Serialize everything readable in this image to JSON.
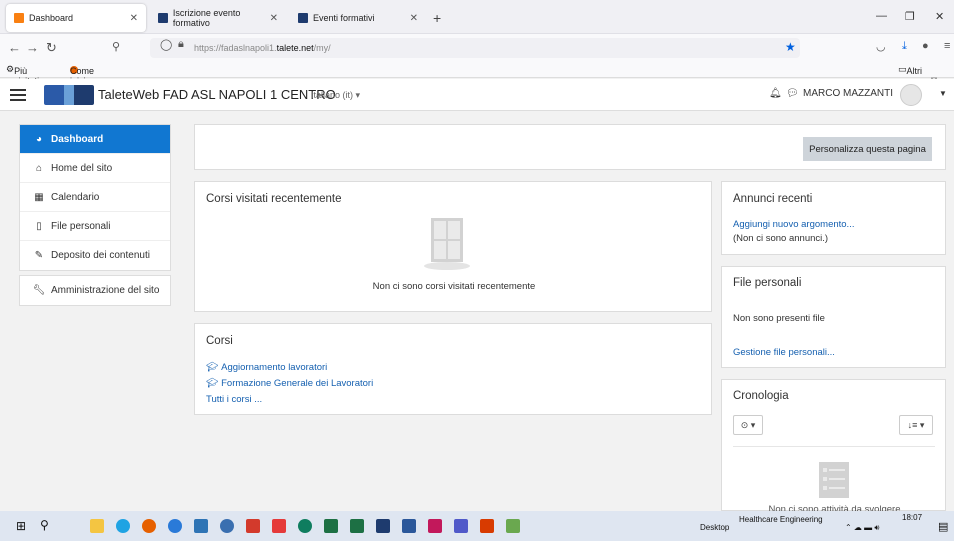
{
  "browser": {
    "tabs": [
      {
        "label": "Dashboard",
        "active": true
      },
      {
        "label": "Iscrizione evento formativo",
        "active": false
      },
      {
        "label": "Eventi formativi",
        "active": false
      }
    ],
    "url_prefix": "https://fadaslnapoli1.",
    "url_domain": "talete.net",
    "url_path": "/my/",
    "bookmarks": [
      "Più visitati",
      "Come iniziare"
    ],
    "other_bookmarks": "Altri segnalib"
  },
  "header": {
    "site_name": "TaleteWeb FAD ASL NAPOLI 1 CENTRO",
    "language": "Italiano (it)",
    "user_name": "MARCO MAZZANTI"
  },
  "sidenav": {
    "group1": [
      {
        "label": "Dashboard",
        "icon": "dashboard-icon",
        "active": true
      },
      {
        "label": "Home del sito",
        "icon": "home-icon",
        "active": false
      },
      {
        "label": "Calendario",
        "icon": "calendar-icon",
        "active": false
      },
      {
        "label": "File personali",
        "icon": "file-icon",
        "active": false
      },
      {
        "label": "Deposito dei contenuti",
        "icon": "brush-icon",
        "active": false
      }
    ],
    "group2": [
      {
        "label": "Amministrazione del sito",
        "icon": "wrench-icon",
        "active": false
      }
    ]
  },
  "main": {
    "customize_button": "Personalizza questa pagina",
    "recent_courses": {
      "title": "Corsi visitati recentemente",
      "empty": "Non ci sono corsi visitati recentemente"
    },
    "courses": {
      "title": "Corsi",
      "items": [
        "Aggiornamento lavoratori",
        "Formazione Generale dei Lavoratori"
      ],
      "all_link": "Tutti i corsi ..."
    }
  },
  "right": {
    "news": {
      "title": "Annunci recenti",
      "add_link": "Aggiungi nuovo argomento...",
      "empty": "(Non ci sono annunci.)"
    },
    "files": {
      "title": "File personali",
      "empty": "Non sono presenti file",
      "manage_link": "Gestione file personali..."
    },
    "timeline": {
      "title": "Cronologia",
      "empty": "Non ci sono attività da svolgere"
    }
  },
  "taskbar": {
    "desktop": "Desktop",
    "notification": "Healthcare Engineering",
    "time": "18:07"
  },
  "colors": {
    "accent": "#1177d1",
    "link": "#1560b0",
    "button_grey": "#ced4da"
  }
}
